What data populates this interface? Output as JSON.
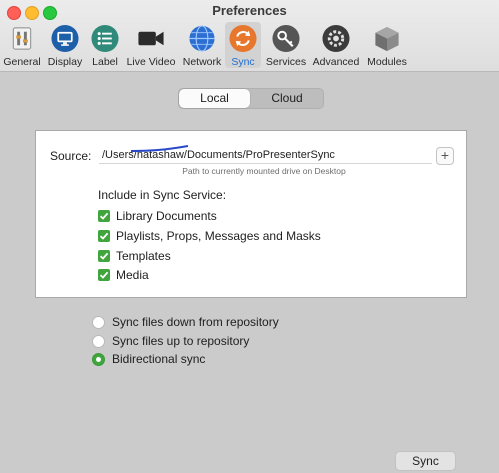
{
  "window": {
    "title": "Preferences"
  },
  "toolbar": {
    "items": [
      {
        "label": "General",
        "icon": "general-icon"
      },
      {
        "label": "Display",
        "icon": "display-icon"
      },
      {
        "label": "Label",
        "icon": "label-icon"
      },
      {
        "label": "Live Video",
        "icon": "video-camera-icon"
      },
      {
        "label": "Network",
        "icon": "globe-icon"
      },
      {
        "label": "Sync",
        "icon": "sync-icon",
        "selected": true
      },
      {
        "label": "Services",
        "icon": "key-icon"
      },
      {
        "label": "Advanced",
        "icon": "gear-icon"
      },
      {
        "label": "Modules",
        "icon": "cube-icon"
      }
    ]
  },
  "segment": {
    "local": "Local",
    "cloud": "Cloud",
    "selected": "Local"
  },
  "source": {
    "label": "Source:",
    "path": "/Users/natashaw/Documents/ProPresenterSync",
    "hint": "Path to currently mounted drive on Desktop",
    "add_button": "+"
  },
  "include": {
    "title": "Include in Sync Service:",
    "items": [
      {
        "label": "Library Documents",
        "checked": true
      },
      {
        "label": "Playlists, Props, Messages and Masks",
        "checked": true
      },
      {
        "label": "Templates",
        "checked": true
      },
      {
        "label": "Media",
        "checked": true
      }
    ]
  },
  "direction": {
    "options": [
      {
        "label": "Sync files down from repository",
        "selected": false
      },
      {
        "label": "Sync files up to repository",
        "selected": false
      },
      {
        "label": "Bidirectional sync",
        "selected": true
      }
    ]
  },
  "actions": {
    "sync_label": "Sync"
  },
  "colors": {
    "accent_blue": "#1f6fd6",
    "check_green": "#3fa53c"
  }
}
